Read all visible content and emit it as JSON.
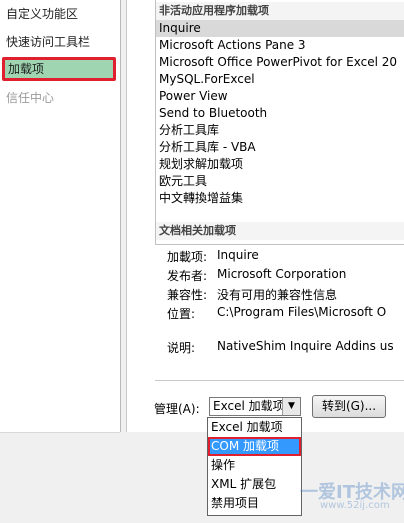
{
  "sidebar": {
    "items": [
      {
        "label": "自定义功能区"
      },
      {
        "label": "快速访问工具栏"
      },
      {
        "label": "加载项"
      },
      {
        "label": "信任中心"
      }
    ]
  },
  "addins": {
    "inactive_header": "非活动应用程序加载项",
    "inactive": [
      "Inquire",
      "Microsoft Actions Pane 3",
      "Microsoft Office PowerPivot for Excel 20",
      "MySQL.ForExcel",
      "Power View",
      "Send to Bluetooth",
      "分析工具库",
      "分析工具库 - VBA",
      "规划求解加载项",
      "欧元工具",
      "中文轉換增益集"
    ],
    "document_header": "文档相关加载项"
  },
  "details": {
    "addin_label": "加載项:",
    "addin_value": "Inquire",
    "publisher_label": "发布者:",
    "publisher_value": "Microsoft Corporation",
    "compat_label": "兼容性:",
    "compat_value": "没有可用的兼容性信息",
    "location_label": "位置:",
    "location_value": "C:\\Program Files\\Microsoft O",
    "desc_label": "说明:",
    "desc_value": "NativeShim Inquire Addins us"
  },
  "manage": {
    "label": "管理(A):",
    "selected": "Excel 加载项",
    "go_label": "转到(G)...",
    "options": [
      "Excel 加载项",
      "COM 加载项",
      "操作",
      "XML 扩展包",
      "禁用项目"
    ]
  },
  "watermark": {
    "text": "一爱IT技术网",
    "sub": "www.52ij.com"
  },
  "colors": {
    "selected_nav": "#9fd5b0",
    "highlight_border": "#e0202e",
    "selected_option": "#3399ff"
  }
}
